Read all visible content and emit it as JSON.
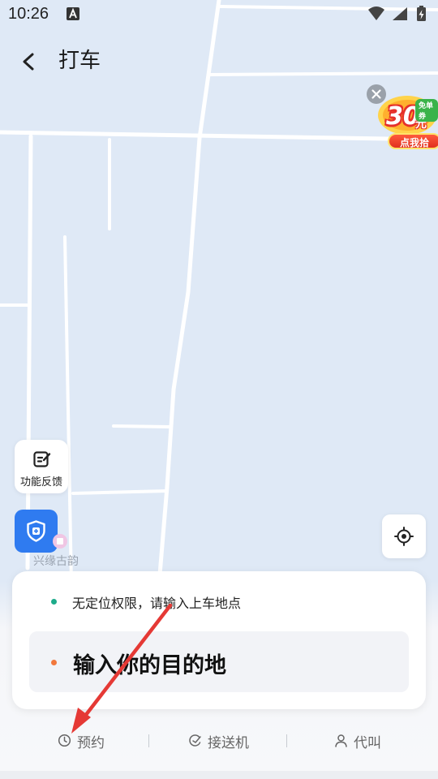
{
  "status_bar": {
    "time": "10:26",
    "icons": [
      "a-notification-icon",
      "wifi-icon",
      "signal-icon",
      "battery-charging-icon"
    ]
  },
  "header": {
    "title": "打车",
    "back_icon": "chevron-left-icon"
  },
  "promo": {
    "tag": "免单券",
    "amount": "30",
    "unit": "元",
    "action": "点我拾",
    "close_icon": "close-icon"
  },
  "map": {
    "poi_label": "兴缘古韵"
  },
  "floating": {
    "feedback_label": "功能反馈",
    "feedback_icon": "edit-note-icon",
    "safety_icon": "shield-plus-icon",
    "locate_icon": "crosshair-icon"
  },
  "trip_card": {
    "pickup_text": "无定位权限，请输入上车地点",
    "destination_placeholder": "输入你的目的地"
  },
  "services": [
    {
      "label": "预约",
      "icon": "clock-icon"
    },
    {
      "label": "接送机",
      "icon": "plane-arrow-icon"
    },
    {
      "label": "代叫",
      "icon": "person-icon"
    }
  ],
  "colors": {
    "map_bg": "#dfe9f6",
    "accent_blue": "#2f7bf0",
    "pickup_dot": "#1dab8a",
    "destination_dot": "#f2783d",
    "annotation_arrow": "#e53935"
  }
}
